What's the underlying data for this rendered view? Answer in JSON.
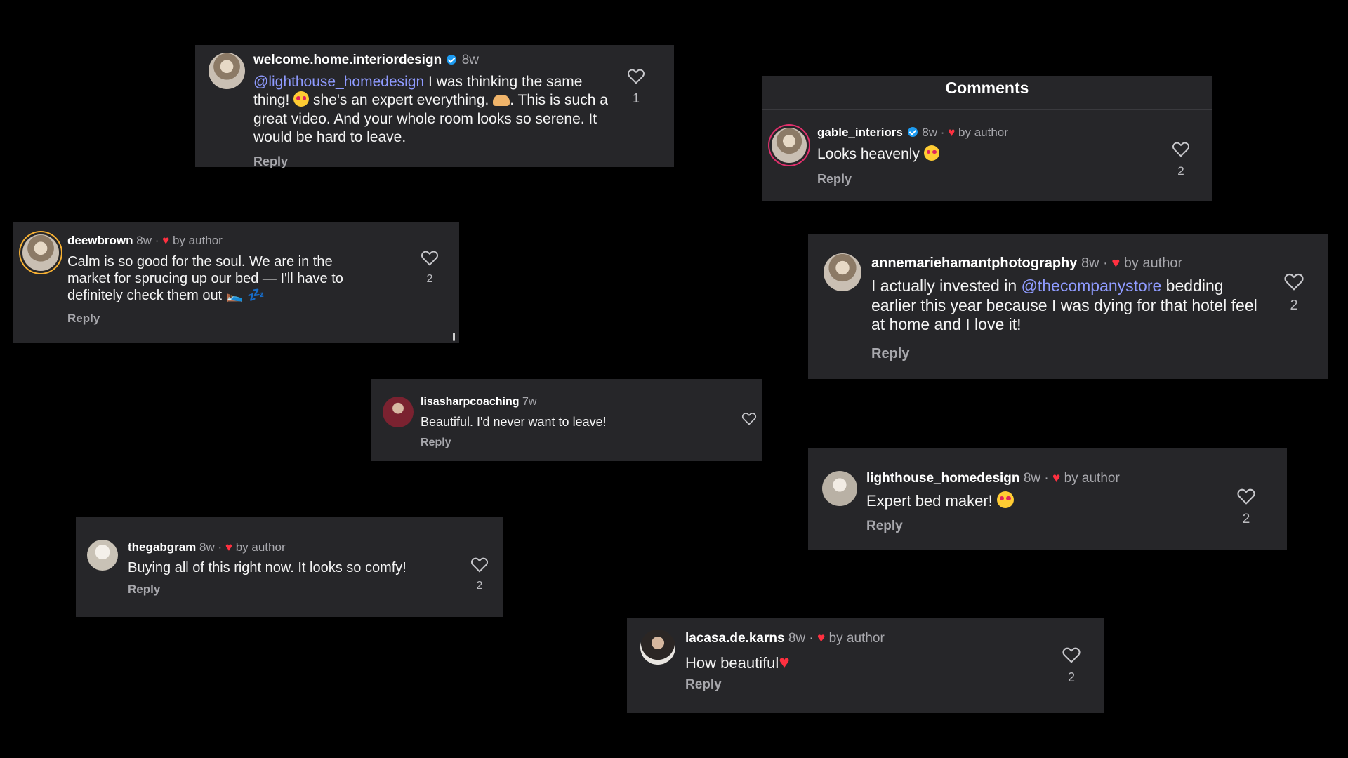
{
  "cards": [
    {
      "id": "welcome",
      "username": "welcome.home.interiordesign",
      "verified": true,
      "time": "8w",
      "mention": "@lighthouse_homedesign",
      "text_a": " I was thinking the same thing! ",
      "text_b": " she's an expert everything. ",
      "text_c": ". This is such a great video.  And your whole room looks so serene.  It would be hard to leave.",
      "reply": "Reply",
      "likes": "1"
    },
    {
      "id": "gable",
      "header": "Comments",
      "username": "gable_interiors",
      "verified": true,
      "time": "8w ·",
      "by": "by author",
      "text": "Looks heavenly ",
      "reply": "Reply",
      "likes": "2"
    },
    {
      "id": "deewbrown",
      "username": "deewbrown",
      "time": "8w ·",
      "by": "by author",
      "text": "Calm is so good for the soul. We are in the market for sprucing up our bed — I'll have to definitely check them out 🛌 💤",
      "reply": "Reply",
      "likes": "2"
    },
    {
      "id": "annemarie",
      "username": "annemariehamantphotography",
      "time": "8w ·",
      "by": "by author",
      "text_a": "I actually invested in ",
      "mention": "@thecompanystore",
      "text_b": " bedding earlier this year because I was dying for that hotel feel at home and I love it!",
      "reply": "Reply",
      "likes": "2"
    },
    {
      "id": "lisasharp",
      "username": "lisasharpcoaching",
      "time": "7w",
      "text": "Beautiful. I'd never want to leave!",
      "reply": "Reply"
    },
    {
      "id": "lighthouse",
      "username": "lighthouse_homedesign",
      "time": "8w ·",
      "by": "by author",
      "text": "Expert bed maker! ",
      "reply": "Reply",
      "likes": "2"
    },
    {
      "id": "thegabgram",
      "username": "thegabgram",
      "time": "8w ·",
      "by": "by author",
      "text": "Buying all of this right now. It looks so comfy!",
      "reply": "Reply",
      "likes": "2"
    },
    {
      "id": "lacasa",
      "username": "lacasa.de.karns",
      "time": "8w ·",
      "by": "by author",
      "text": "How beautiful",
      "reply": "Reply",
      "likes": "2"
    }
  ],
  "colors": {
    "background": "#000000",
    "card": "#262629",
    "mention": "#8f9bff",
    "heart": "#ff3040"
  }
}
